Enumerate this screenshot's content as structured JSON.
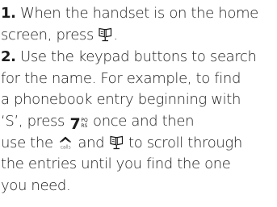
{
  "instructions": {
    "step1": {
      "number": "1.",
      "line1_text": " When the handset is on the home",
      "line2_text": "screen, press ",
      "line2_end": ".",
      "icon": "phonebook-icon"
    },
    "step2": {
      "number": "2.",
      "line1_text": " Use the keypad buttons to search",
      "line2": "for the name. For example, to find",
      "line3": "a phonebook entry beginning with",
      "line4_start": "‘S’, press ",
      "key_digit": "7",
      "key_letters_top": "PQ",
      "key_letters_bottom": "RS",
      "line4_end": " once and then",
      "line5_start": "use the ",
      "line5_calls_icon_label": "calls",
      "line5_middle": " and ",
      "line5_end": " to scroll through",
      "line6": "the entries until you find the one",
      "line7": "you need.",
      "calls_icon": "calls-icon",
      "phonebook_icon": "phonebook-icon"
    }
  }
}
